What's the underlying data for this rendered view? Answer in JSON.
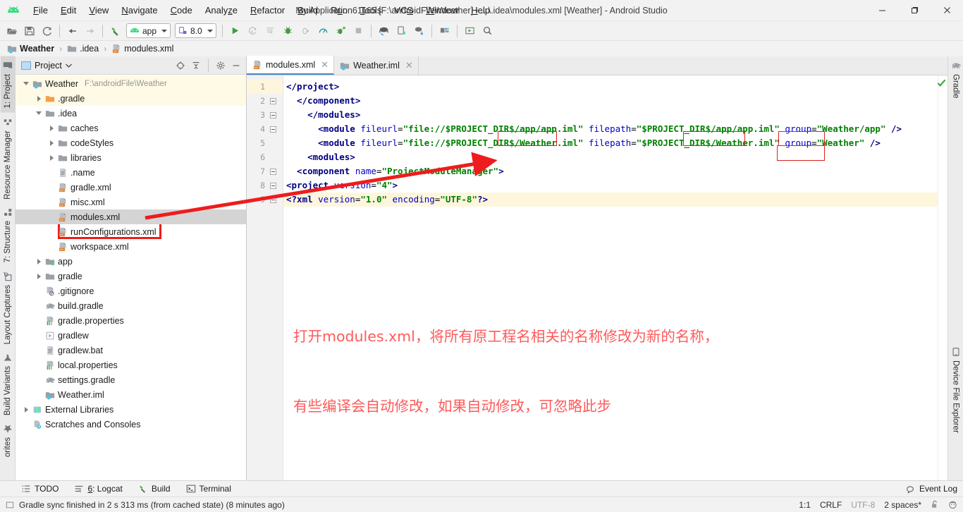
{
  "window": {
    "title": "My Application61165 [F:\\androidFile\\Weather] - ...\\.idea\\modules.xml [Weather] - Android Studio",
    "minimize_label": "─",
    "maximize_label": "❐",
    "close_label": "✕",
    "logo_icon": "android-studio-logo"
  },
  "menubar": {
    "items": [
      {
        "label": "File",
        "mnemonic": "F"
      },
      {
        "label": "Edit",
        "mnemonic": "E"
      },
      {
        "label": "View",
        "mnemonic": "V"
      },
      {
        "label": "Navigate",
        "mnemonic": "N"
      },
      {
        "label": "Code",
        "mnemonic": "C"
      },
      {
        "label": "Analyze",
        "mnemonic": "z"
      },
      {
        "label": "Refactor",
        "mnemonic": "R"
      },
      {
        "label": "Build",
        "mnemonic": "B"
      },
      {
        "label": "Run",
        "mnemonic": "u"
      },
      {
        "label": "Tools",
        "mnemonic": "T"
      },
      {
        "label": "VCS",
        "mnemonic": "S"
      },
      {
        "label": "Window",
        "mnemonic": "W"
      },
      {
        "label": "Help",
        "mnemonic": "H"
      }
    ]
  },
  "toolbar": {
    "open_icon": "open-folder-icon",
    "save_icon": "save-icon",
    "sync_icon": "sync-refresh-icon",
    "back_icon": "arrow-back-icon",
    "forward_icon": "arrow-forward-icon",
    "build_icon": "hammer-build-icon",
    "module_selector": {
      "label": "app",
      "icon": "android-module-icon"
    },
    "device_selector": {
      "label": "8.0",
      "icon": "device-icon"
    },
    "run_icon": "run-play-icon",
    "apply_changes_icon": "apply-changes-icon",
    "apply_code_changes_icon": "apply-code-changes-icon",
    "debug_icon": "debug-bug-icon",
    "attach_debugger_icon": "attach-debugger-icon",
    "profiler_icon": "profiler-icon",
    "run_with_coverage_icon": "debug-arrow-icon",
    "stop_icon": "stop-square-icon",
    "sdk_manager_icon": "sdk-manager-icon",
    "avd_manager_icon": "avd-manager-icon",
    "sync_project_icon": "sync-project-gradle-icon",
    "project_structure_icon": "project-structure-icon",
    "layout_inspector_icon": "layout-inspector-icon",
    "search_icon": "search-icon"
  },
  "breadcrumb": {
    "items": [
      {
        "label": "Weather",
        "icon": "module-icon",
        "bold": true
      },
      {
        "label": ".idea",
        "icon": "folder-icon",
        "bold": false
      },
      {
        "label": "modules.xml",
        "icon": "xml-file-icon",
        "bold": false
      }
    ],
    "separator": "›"
  },
  "left_tool_strip": {
    "tabs": [
      {
        "label": "1: Project",
        "icon": "project-folder-icon",
        "active": true
      },
      {
        "label": "Resource Manager",
        "icon": "resource-manager-icon",
        "active": false
      },
      {
        "label": "7: Structure",
        "icon": "structure-icon",
        "active": false
      },
      {
        "label": "Layout Captures",
        "icon": "layout-captures-icon",
        "active": false
      },
      {
        "label": "Build Variants",
        "icon": "build-variants-icon",
        "active": false
      },
      {
        "label": "orites",
        "icon": "favorites-icon",
        "active": false
      }
    ]
  },
  "right_tool_strip": {
    "tabs": [
      {
        "label": "Gradle",
        "icon": "gradle-elephant-icon"
      },
      {
        "label": "Device File Explorer",
        "icon": "device-file-explorer-icon"
      }
    ]
  },
  "project_panel": {
    "title": "Project",
    "title_icon": "project-view-icon",
    "dropdown_icon": "chevron-down-icon",
    "actions": [
      {
        "name": "select-opened-file",
        "icon": "crosshair-target-icon"
      },
      {
        "name": "collapse-all",
        "icon": "collapse-all-icon"
      },
      {
        "name": "settings",
        "icon": "gear-icon"
      },
      {
        "name": "hide",
        "icon": "minimize-icon"
      }
    ],
    "tree": [
      {
        "label": "Weather",
        "path": "F:\\androidFile\\Weather",
        "icon": "module-icon",
        "indent": 0,
        "arrow": "down",
        "state": "yellow"
      },
      {
        "label": ".gradle",
        "icon": "folder-orange-icon",
        "indent": 1,
        "arrow": "right",
        "state": "yellow"
      },
      {
        "label": ".idea",
        "icon": "folder-icon",
        "indent": 1,
        "arrow": "down",
        "state": "normal"
      },
      {
        "label": "caches",
        "icon": "folder-icon",
        "indent": 2,
        "arrow": "right",
        "state": "normal"
      },
      {
        "label": "codeStyles",
        "icon": "folder-icon",
        "indent": 2,
        "arrow": "right",
        "state": "normal"
      },
      {
        "label": "libraries",
        "icon": "folder-icon",
        "indent": 2,
        "arrow": "right",
        "state": "normal"
      },
      {
        "label": ".name",
        "icon": "text-file-icon",
        "indent": 2,
        "arrow": "none",
        "state": "normal"
      },
      {
        "label": "gradle.xml",
        "icon": "xml-file-icon",
        "indent": 2,
        "arrow": "none",
        "state": "normal"
      },
      {
        "label": "misc.xml",
        "icon": "xml-file-icon",
        "indent": 2,
        "arrow": "none",
        "state": "normal"
      },
      {
        "label": "modules.xml",
        "icon": "xml-file-icon",
        "indent": 2,
        "arrow": "none",
        "state": "selected"
      },
      {
        "label": "runConfigurations.xml",
        "icon": "xml-file-icon",
        "indent": 2,
        "arrow": "none",
        "state": "normal"
      },
      {
        "label": "workspace.xml",
        "icon": "xml-file-icon",
        "indent": 2,
        "arrow": "none",
        "state": "normal"
      },
      {
        "label": "app",
        "icon": "module-green-icon",
        "indent": 1,
        "arrow": "right",
        "state": "normal"
      },
      {
        "label": "gradle",
        "icon": "folder-icon",
        "indent": 1,
        "arrow": "right",
        "state": "normal"
      },
      {
        "label": ".gitignore",
        "icon": "gitignore-icon",
        "indent": 1,
        "arrow": "none",
        "state": "normal"
      },
      {
        "label": "build.gradle",
        "icon": "gradle-elephant-icon",
        "indent": 1,
        "arrow": "none",
        "state": "normal"
      },
      {
        "label": "gradle.properties",
        "icon": "properties-file-icon",
        "indent": 1,
        "arrow": "none",
        "state": "normal"
      },
      {
        "label": "gradlew",
        "icon": "script-file-icon",
        "indent": 1,
        "arrow": "none",
        "state": "normal"
      },
      {
        "label": "gradlew.bat",
        "icon": "text-file-icon",
        "indent": 1,
        "arrow": "none",
        "state": "normal"
      },
      {
        "label": "local.properties",
        "icon": "properties-file-icon",
        "indent": 1,
        "arrow": "none",
        "state": "normal"
      },
      {
        "label": "settings.gradle",
        "icon": "gradle-elephant-icon",
        "indent": 1,
        "arrow": "none",
        "state": "normal"
      },
      {
        "label": "Weather.iml",
        "icon": "module-icon",
        "indent": 1,
        "arrow": "none",
        "state": "normal"
      },
      {
        "label": "External Libraries",
        "icon": "external-libraries-icon",
        "indent": 0,
        "arrow": "right",
        "state": "normal"
      },
      {
        "label": "Scratches and Consoles",
        "icon": "scratches-icon",
        "indent": 0,
        "arrow": "none",
        "state": "normal"
      }
    ]
  },
  "editor": {
    "tabs": [
      {
        "label": "modules.xml",
        "icon": "xml-file-icon",
        "active": true,
        "close": "✕"
      },
      {
        "label": "Weather.iml",
        "icon": "module-icon",
        "active": false,
        "close": "✕"
      }
    ],
    "inspection_ok_icon": "checkmark-green-icon",
    "lines": [
      {
        "number": 1,
        "current": true,
        "fold": false,
        "tokens": [
          {
            "t": "<?xml ",
            "c": "k-tag"
          },
          {
            "t": "version",
            "c": "k-attr"
          },
          {
            "t": "=",
            "c": "k-punct"
          },
          {
            "t": "\"1.0\"",
            "c": "k-val"
          },
          {
            "t": " ",
            "c": "k-plain"
          },
          {
            "t": "encoding",
            "c": "k-attr"
          },
          {
            "t": "=",
            "c": "k-punct"
          },
          {
            "t": "\"UTF-8\"",
            "c": "k-val"
          },
          {
            "t": "?>",
            "c": "k-tag"
          }
        ]
      },
      {
        "number": 2,
        "current": false,
        "fold": true,
        "tokens": [
          {
            "t": "<project ",
            "c": "k-tag"
          },
          {
            "t": "version",
            "c": "k-attr"
          },
          {
            "t": "=",
            "c": "k-punct"
          },
          {
            "t": "\"4\"",
            "c": "k-val"
          },
          {
            "t": ">",
            "c": "k-tag"
          }
        ]
      },
      {
        "number": 3,
        "current": false,
        "fold": true,
        "tokens": [
          {
            "t": "  <component ",
            "c": "k-tag"
          },
          {
            "t": "name",
            "c": "k-attr"
          },
          {
            "t": "=",
            "c": "k-punct"
          },
          {
            "t": "\"ProjectModuleManager\"",
            "c": "k-val"
          },
          {
            "t": ">",
            "c": "k-tag"
          }
        ]
      },
      {
        "number": 4,
        "current": false,
        "fold": true,
        "tokens": [
          {
            "t": "    <modules>",
            "c": "k-tag"
          }
        ]
      },
      {
        "number": 5,
        "current": false,
        "fold": false,
        "tokens": [
          {
            "t": "      <module ",
            "c": "k-tag"
          },
          {
            "t": "fileurl",
            "c": "k-attr"
          },
          {
            "t": "=",
            "c": "k-punct"
          },
          {
            "t": "\"file://$PROJECT_DIR$/Weather.iml\"",
            "c": "k-val"
          },
          {
            "t": " ",
            "c": "k-plain"
          },
          {
            "t": "filepath",
            "c": "k-attr"
          },
          {
            "t": "=",
            "c": "k-punct"
          },
          {
            "t": "\"$PROJECT_DIR$/Weather.iml\"",
            "c": "k-val"
          },
          {
            "t": " ",
            "c": "k-plain"
          },
          {
            "t": "group",
            "c": "k-attr"
          },
          {
            "t": "=",
            "c": "k-punct"
          },
          {
            "t": "\"Weather\"",
            "c": "k-val"
          },
          {
            "t": " />",
            "c": "k-tag"
          }
        ]
      },
      {
        "number": 6,
        "current": false,
        "fold": false,
        "tokens": [
          {
            "t": "      <module ",
            "c": "k-tag"
          },
          {
            "t": "fileurl",
            "c": "k-attr"
          },
          {
            "t": "=",
            "c": "k-punct"
          },
          {
            "t": "\"file://$PROJECT_DIR$/app/app.iml\"",
            "c": "k-val"
          },
          {
            "t": " ",
            "c": "k-plain"
          },
          {
            "t": "filepath",
            "c": "k-attr"
          },
          {
            "t": "=",
            "c": "k-punct"
          },
          {
            "t": "\"$PROJECT_DIR$/app/app.iml\"",
            "c": "k-val"
          },
          {
            "t": " ",
            "c": "k-plain"
          },
          {
            "t": "group",
            "c": "k-attr"
          },
          {
            "t": "=",
            "c": "k-punct"
          },
          {
            "t": "\"Weather/app\"",
            "c": "k-val"
          },
          {
            "t": " />",
            "c": "k-tag"
          }
        ]
      },
      {
        "number": 7,
        "current": false,
        "fold": true,
        "tokens": [
          {
            "t": "    </modules>",
            "c": "k-tag"
          }
        ]
      },
      {
        "number": 8,
        "current": false,
        "fold": true,
        "tokens": [
          {
            "t": "  </component>",
            "c": "k-tag"
          }
        ]
      },
      {
        "number": 9,
        "current": false,
        "fold": true,
        "tokens": [
          {
            "t": "</project>",
            "c": "k-tag"
          }
        ]
      }
    ]
  },
  "annotation": {
    "line1": "打开modules.xml，将所有原工程名相关的名称修改为新的名称，",
    "line2": "有些编译会自动修改，如果自动修改，可忽略此步",
    "color": "#ff5a5a",
    "arrow_color": "#ee1c1c",
    "highlight_color": "#e02020"
  },
  "bottom_bar": {
    "items": [
      {
        "label": "TODO",
        "icon": "todo-list-icon",
        "mnemonic": ""
      },
      {
        "label": "6: Logcat",
        "icon": "logcat-icon",
        "mnemonic": "6"
      },
      {
        "label": "Build",
        "icon": "hammer-build-icon",
        "mnemonic": ""
      },
      {
        "label": "Terminal",
        "icon": "terminal-icon",
        "mnemonic": ""
      }
    ],
    "event_log": {
      "label": "Event Log",
      "icon": "event-log-icon"
    }
  },
  "status_bar": {
    "message": "Gradle sync finished in 2 s 313 ms (from cached state) (8 minutes ago)",
    "message_icon": "status-message-icon",
    "caret_position": "1:1",
    "line_separator": "CRLF",
    "encoding": "UTF-8",
    "indent": "2 spaces*",
    "lock_icon": "unlocked-padlock-icon",
    "inspection_icon": "inspection-face-icon"
  }
}
